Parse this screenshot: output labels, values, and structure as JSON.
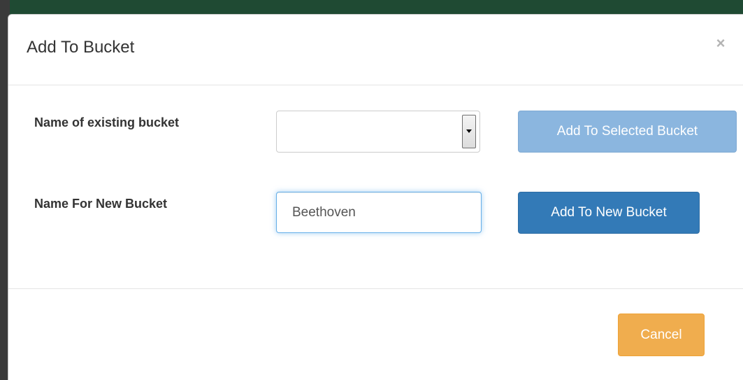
{
  "modal": {
    "title": "Add To Bucket",
    "close_label": "×"
  },
  "form": {
    "existing_label": "Name of existing bucket",
    "existing_selected": "",
    "new_label": "Name For New Bucket",
    "new_value": "Beethoven"
  },
  "buttons": {
    "add_selected": "Add To Selected Bucket",
    "add_new": "Add To New Bucket",
    "cancel": "Cancel"
  },
  "icons": {
    "close": "close-icon",
    "dropdown": "chevron-down-icon"
  },
  "colors": {
    "primary": "#337ab7",
    "primary_disabled": "#8bb6df",
    "warning": "#f0ad4e"
  }
}
